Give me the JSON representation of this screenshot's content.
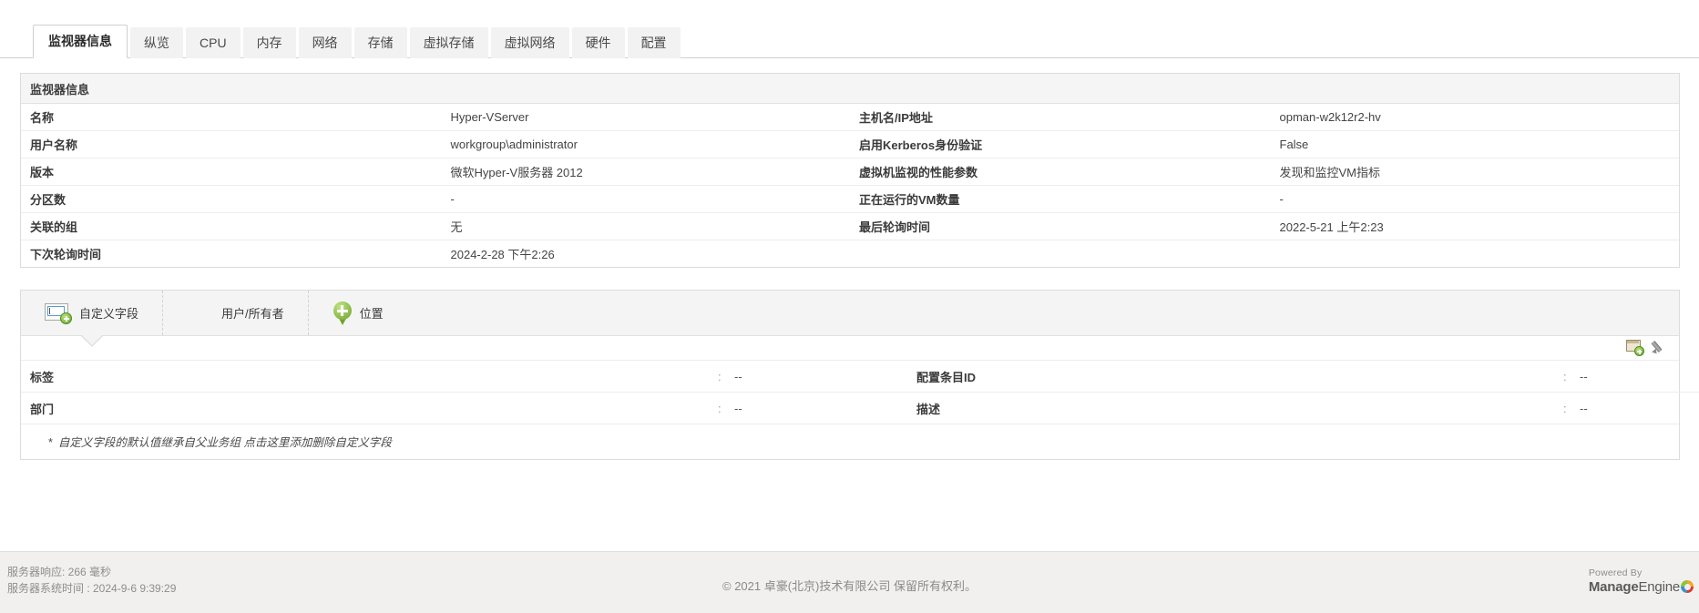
{
  "tabs": [
    {
      "label": "监视器信息",
      "active": true
    },
    {
      "label": "纵览",
      "active": false
    },
    {
      "label": "CPU",
      "active": false
    },
    {
      "label": "内存",
      "active": false
    },
    {
      "label": "网络",
      "active": false
    },
    {
      "label": "存储",
      "active": false
    },
    {
      "label": "虚拟存储",
      "active": false
    },
    {
      "label": "虚拟网络",
      "active": false
    },
    {
      "label": "硬件",
      "active": false
    },
    {
      "label": "配置",
      "active": false
    }
  ],
  "panel": {
    "title": "监视器信息",
    "rows": [
      {
        "k1": "名称",
        "v1": "Hyper-VServer",
        "k2": "主机名/IP地址",
        "v2": "opman-w2k12r2-hv"
      },
      {
        "k1": "用户名称",
        "v1": "workgroup\\administrator",
        "k2": "启用Kerberos身份验证",
        "v2": "False"
      },
      {
        "k1": "版本",
        "v1": "微软Hyper-V服务器 2012",
        "k2": "虚拟机监视的性能参数",
        "v2": "发现和监控VM指标"
      },
      {
        "k1": "分区数",
        "v1": "-",
        "k2": "正在运行的VM数量",
        "v2": "-"
      },
      {
        "k1": "关联的组",
        "v1": "无",
        "k2": "最后轮询时间",
        "v2": "2022-5-21 上午2:23"
      },
      {
        "k1": "下次轮询时间",
        "v1": "2024-2-28 下午2:26",
        "k2": "",
        "v2": ""
      }
    ]
  },
  "custom_fields": {
    "tabs": [
      {
        "label": "自定义字段",
        "icon": "custom-field-icon",
        "active": true
      },
      {
        "label": "用户/所有者",
        "icon": "users-icon",
        "active": false
      },
      {
        "label": "位置",
        "icon": "location-pin-icon",
        "active": false
      }
    ],
    "actions": [
      {
        "name": "add-custom-field-icon",
        "title": "添加"
      },
      {
        "name": "edit-icon",
        "title": "编辑"
      }
    ],
    "separator": ":",
    "rows": [
      {
        "k1": "标签",
        "v1": "--",
        "k2": "配置条目ID",
        "v2": "--"
      },
      {
        "k1": "部门",
        "v1": "--",
        "k2": "描述",
        "v2": "--"
      }
    ],
    "note_star": "*",
    "note_text": "自定义字段的默认值继承自父业务组 点击这里添加删除自定义字段"
  },
  "footer": {
    "server_response": "服务器响应: 266 毫秒",
    "server_time": "服务器系统时间 : 2024-9-6 9:39:29",
    "copyright": "© 2021 卓豪(北京)技术有限公司  保留所有权利。",
    "powered_by": "Powered By",
    "brand_bold": "Manage",
    "brand_light": "Engine"
  }
}
